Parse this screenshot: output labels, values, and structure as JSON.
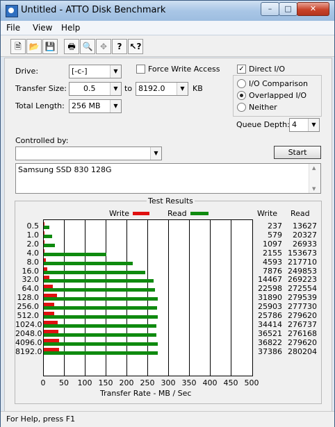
{
  "window": {
    "title": "Untitled - ATTO Disk Benchmark"
  },
  "menu": {
    "items": [
      "File",
      "View",
      "Help"
    ]
  },
  "toolbar": {
    "icons": [
      "new-document-icon",
      "open-folder-icon",
      "save-disk-icon",
      "print-icon",
      "print-preview-icon",
      "move-icon",
      "help-question-icon",
      "context-help-icon"
    ]
  },
  "settings": {
    "drive_label": "Drive:",
    "drive_value": "[-c-]",
    "transfer_size_label": "Transfer Size:",
    "transfer_from": "0.5",
    "to_label": "to",
    "transfer_to": "8192.0",
    "kb_label": "KB",
    "total_length_label": "Total Length:",
    "total_length_value": "256 MB",
    "force_write_label": "Force Write Access",
    "force_write_checked": false,
    "direct_io_label": "Direct I/O",
    "direct_io_checked": true,
    "io_comparison_label": "I/O Comparison",
    "overlapped_io_label": "Overlapped I/O",
    "neither_label": "Neither",
    "selected_mode": "Overlapped I/O",
    "queue_depth_label": "Queue Depth:",
    "queue_depth_value": "4",
    "controlled_by_label": "Controlled by:",
    "controlled_by_value": "",
    "start_label": "Start",
    "description": "Samsung SSD 830 128G"
  },
  "results": {
    "title": "Test Results",
    "write_legend": "Write",
    "read_legend": "Read",
    "write_col_header": "Write",
    "read_col_header": "Read",
    "write_color": "#e01010",
    "read_color": "#0f8a0f",
    "x_axis_label": "Transfer Rate - MB / Sec",
    "x_ticks": [
      "0",
      "50",
      "100",
      "150",
      "200",
      "250",
      "300",
      "350",
      "400",
      "450",
      "500"
    ]
  },
  "chart_data": {
    "type": "bar",
    "orientation": "horizontal",
    "categories": [
      "0.5",
      "1.0",
      "2.0",
      "4.0",
      "8.0",
      "16.0",
      "32.0",
      "64.0",
      "128.0",
      "256.0",
      "512.0",
      "1024.0",
      "2048.0",
      "4096.0",
      "8192.0"
    ],
    "series": [
      {
        "name": "Write",
        "values_kb": [
          237,
          579,
          1097,
          2155,
          4593,
          7876,
          14467,
          22598,
          31890,
          25903,
          25786,
          34414,
          36521,
          36822,
          37386
        ]
      },
      {
        "name": "Read",
        "values_kb": [
          13627,
          20327,
          26933,
          153673,
          217710,
          249853,
          269223,
          272554,
          279539,
          277730,
          279620,
          276737,
          276168,
          279620,
          280204
        ]
      }
    ],
    "xlabel": "Transfer Rate - MB / Sec",
    "xlim": [
      0,
      500
    ],
    "grid": true,
    "legend": "top"
  },
  "status": {
    "text": "For Help, press F1"
  }
}
